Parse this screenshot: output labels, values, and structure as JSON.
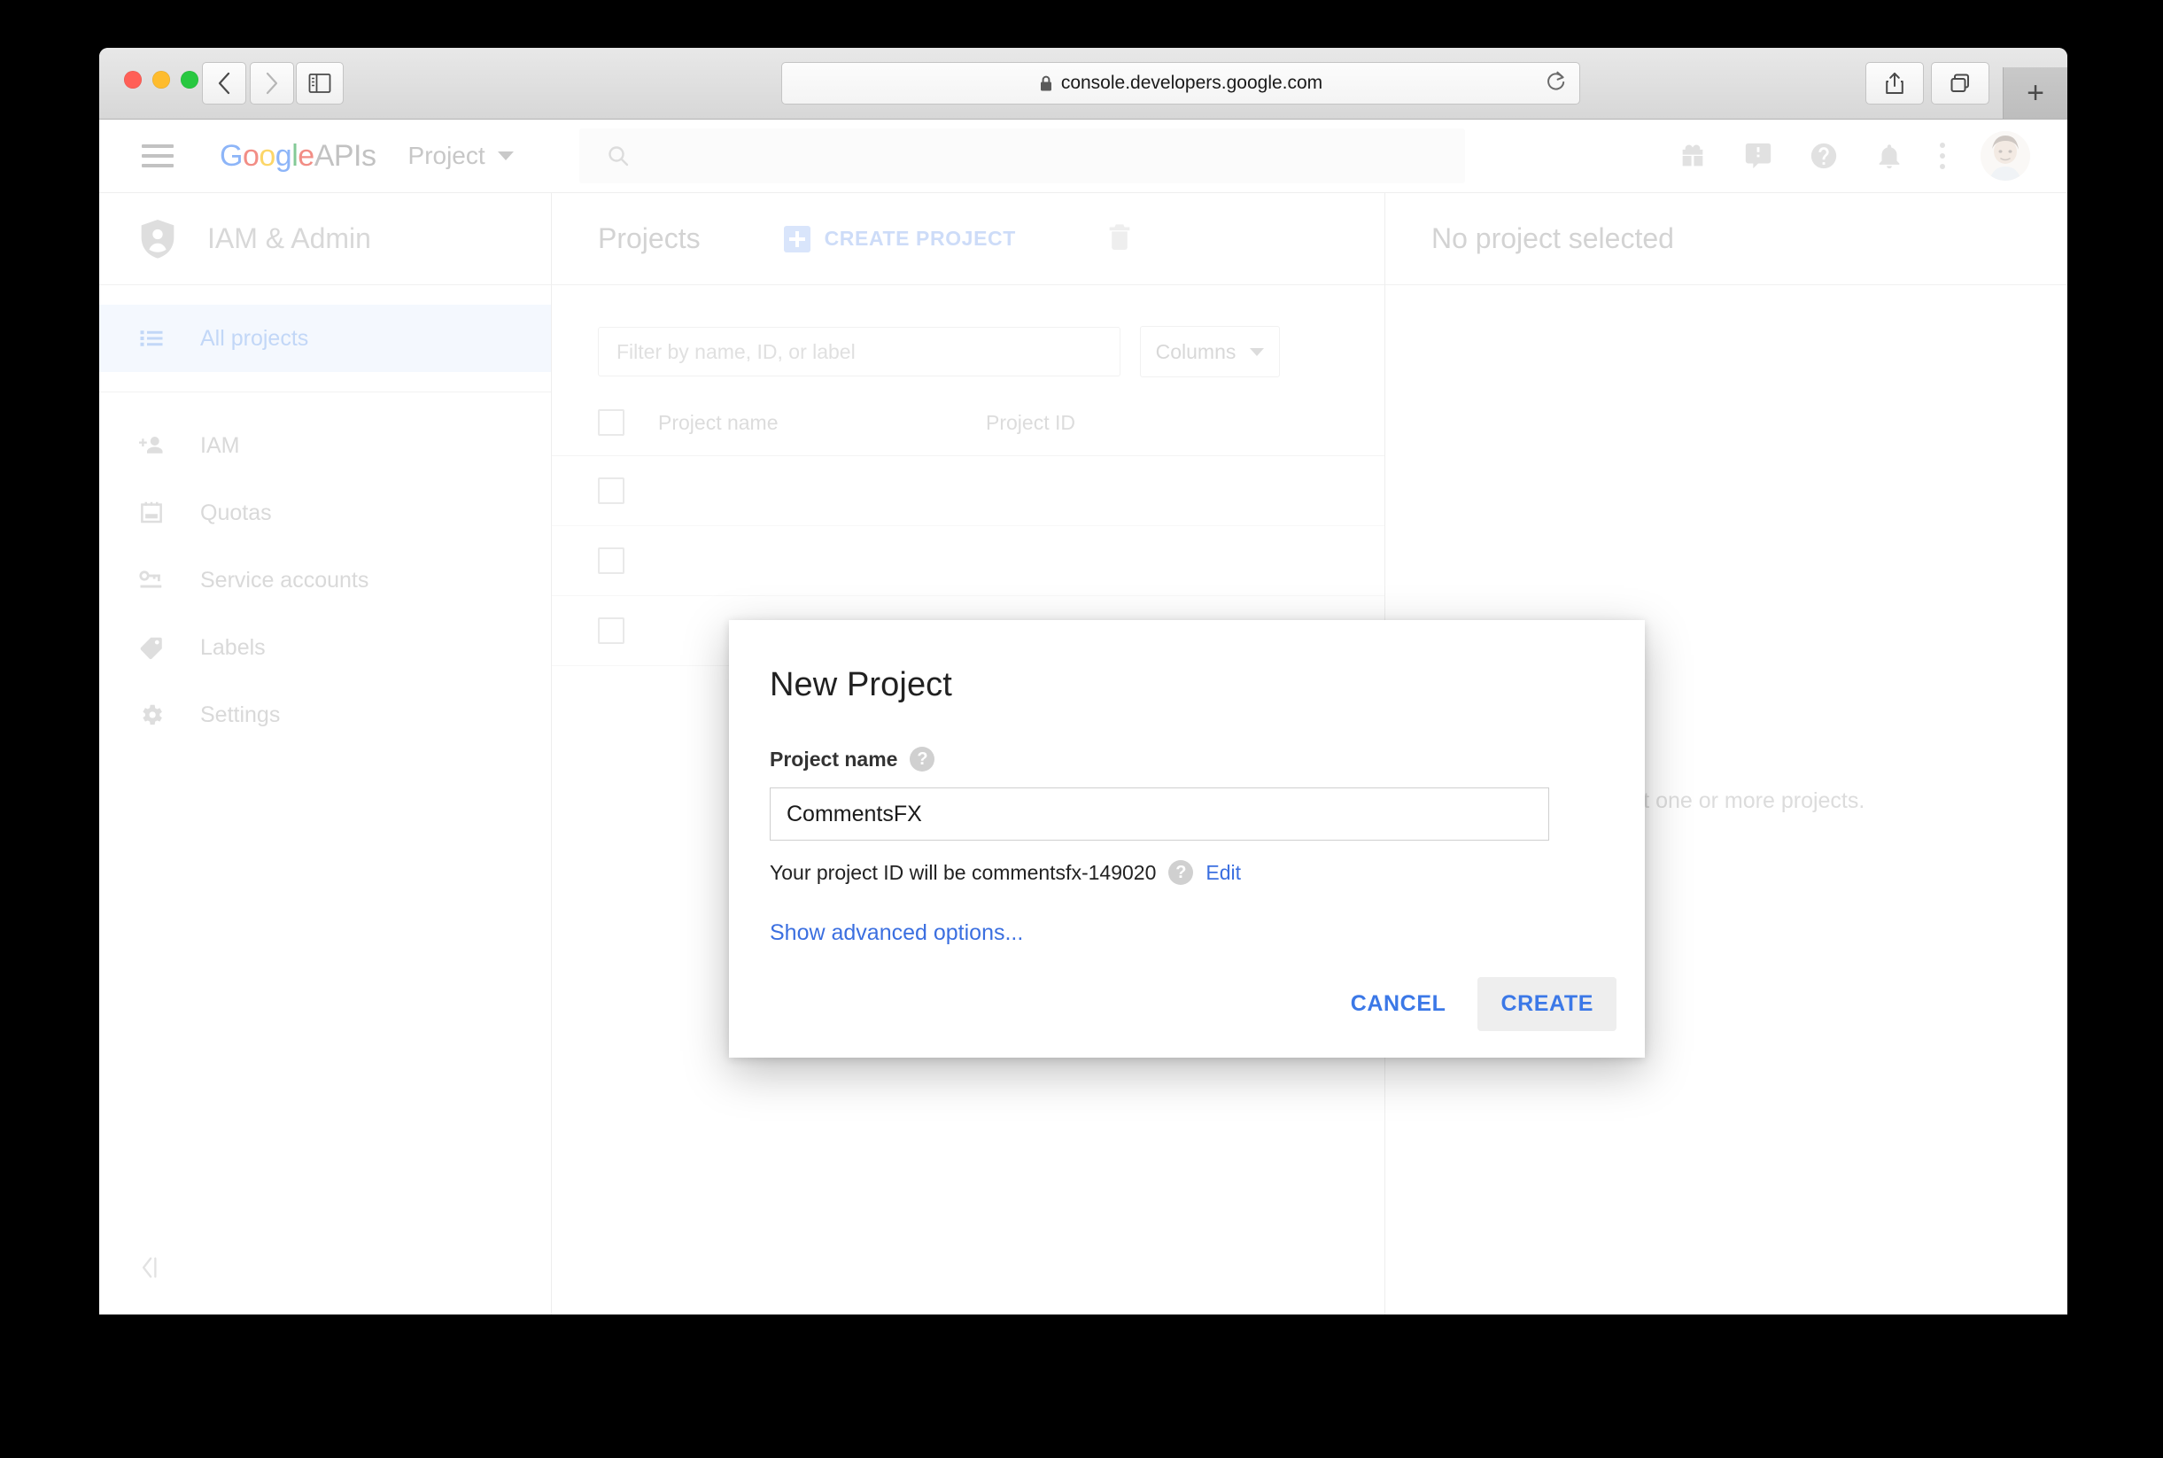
{
  "browser": {
    "url": "console.developers.google.com",
    "lock_icon": "lock-icon",
    "back_icon": "chevron-left-icon",
    "forward_icon": "chevron-right-icon",
    "sidebar_icon": "sidebar-panel-icon",
    "reload_icon": "reload-icon",
    "share_icon": "share-icon",
    "tabs_icon": "tab-overview-icon",
    "newtab_label": "+"
  },
  "gcp_header": {
    "menu_icon": "hamburger-menu-icon",
    "logo": {
      "g1": "G",
      "o1": "o",
      "o2": "o",
      "g2": "g",
      "l": "l",
      "e": "e",
      "apis": "APIs"
    },
    "project_picker_label": "Project",
    "search_placeholder": "",
    "search_icon": "search-icon",
    "icons": [
      "gift-icon",
      "feedback-icon",
      "help-icon",
      "notifications-bell-icon",
      "more-vert-icon"
    ],
    "avatar": "user-avatar"
  },
  "sidebar": {
    "title": "IAM & Admin",
    "title_icon": "shield-person-icon",
    "collapse_icon": "collapse-panel-icon",
    "items": [
      {
        "label": "All projects",
        "icon": "list-icon",
        "active": true
      },
      {
        "label": "IAM",
        "icon": "person-add-icon",
        "active": false
      },
      {
        "label": "Quotas",
        "icon": "quota-icon",
        "active": false
      },
      {
        "label": "Service accounts",
        "icon": "key-icon",
        "active": false
      },
      {
        "label": "Labels",
        "icon": "label-tag-icon",
        "active": false
      },
      {
        "label": "Settings",
        "icon": "gear-icon",
        "active": false
      }
    ]
  },
  "projects_panel": {
    "title": "Projects",
    "create_button": "CREATE PROJECT",
    "create_icon": "plus-square-icon",
    "delete_icon": "trash-icon",
    "filter_placeholder": "Filter by name, ID, or label",
    "columns_button": "Columns",
    "table": {
      "headers": [
        "Project name",
        "Project ID"
      ],
      "rows": [
        {
          "name": "",
          "id": ""
        },
        {
          "name": "",
          "id": ""
        },
        {
          "name": "",
          "id": ""
        }
      ]
    }
  },
  "detail_panel": {
    "title": "No project selected",
    "empty_text": "Select one or more projects."
  },
  "dialog": {
    "title": "New Project",
    "field_label": "Project name",
    "field_help_icon": "help-icon",
    "project_name_value": "CommentsFX",
    "project_id_text": "Your project ID will be commentsfx-149020",
    "project_id_help_icon": "help-icon",
    "edit_link": "Edit",
    "advanced_link": "Show advanced options...",
    "cancel_button": "CANCEL",
    "create_button": "CREATE"
  },
  "colors": {
    "link_blue": "#3b78e7",
    "google_blue": "#4285F4",
    "google_red": "#EA4335",
    "google_yellow": "#FBBC05",
    "google_green": "#34A853",
    "active_row_bg": "#f4f8fe"
  }
}
